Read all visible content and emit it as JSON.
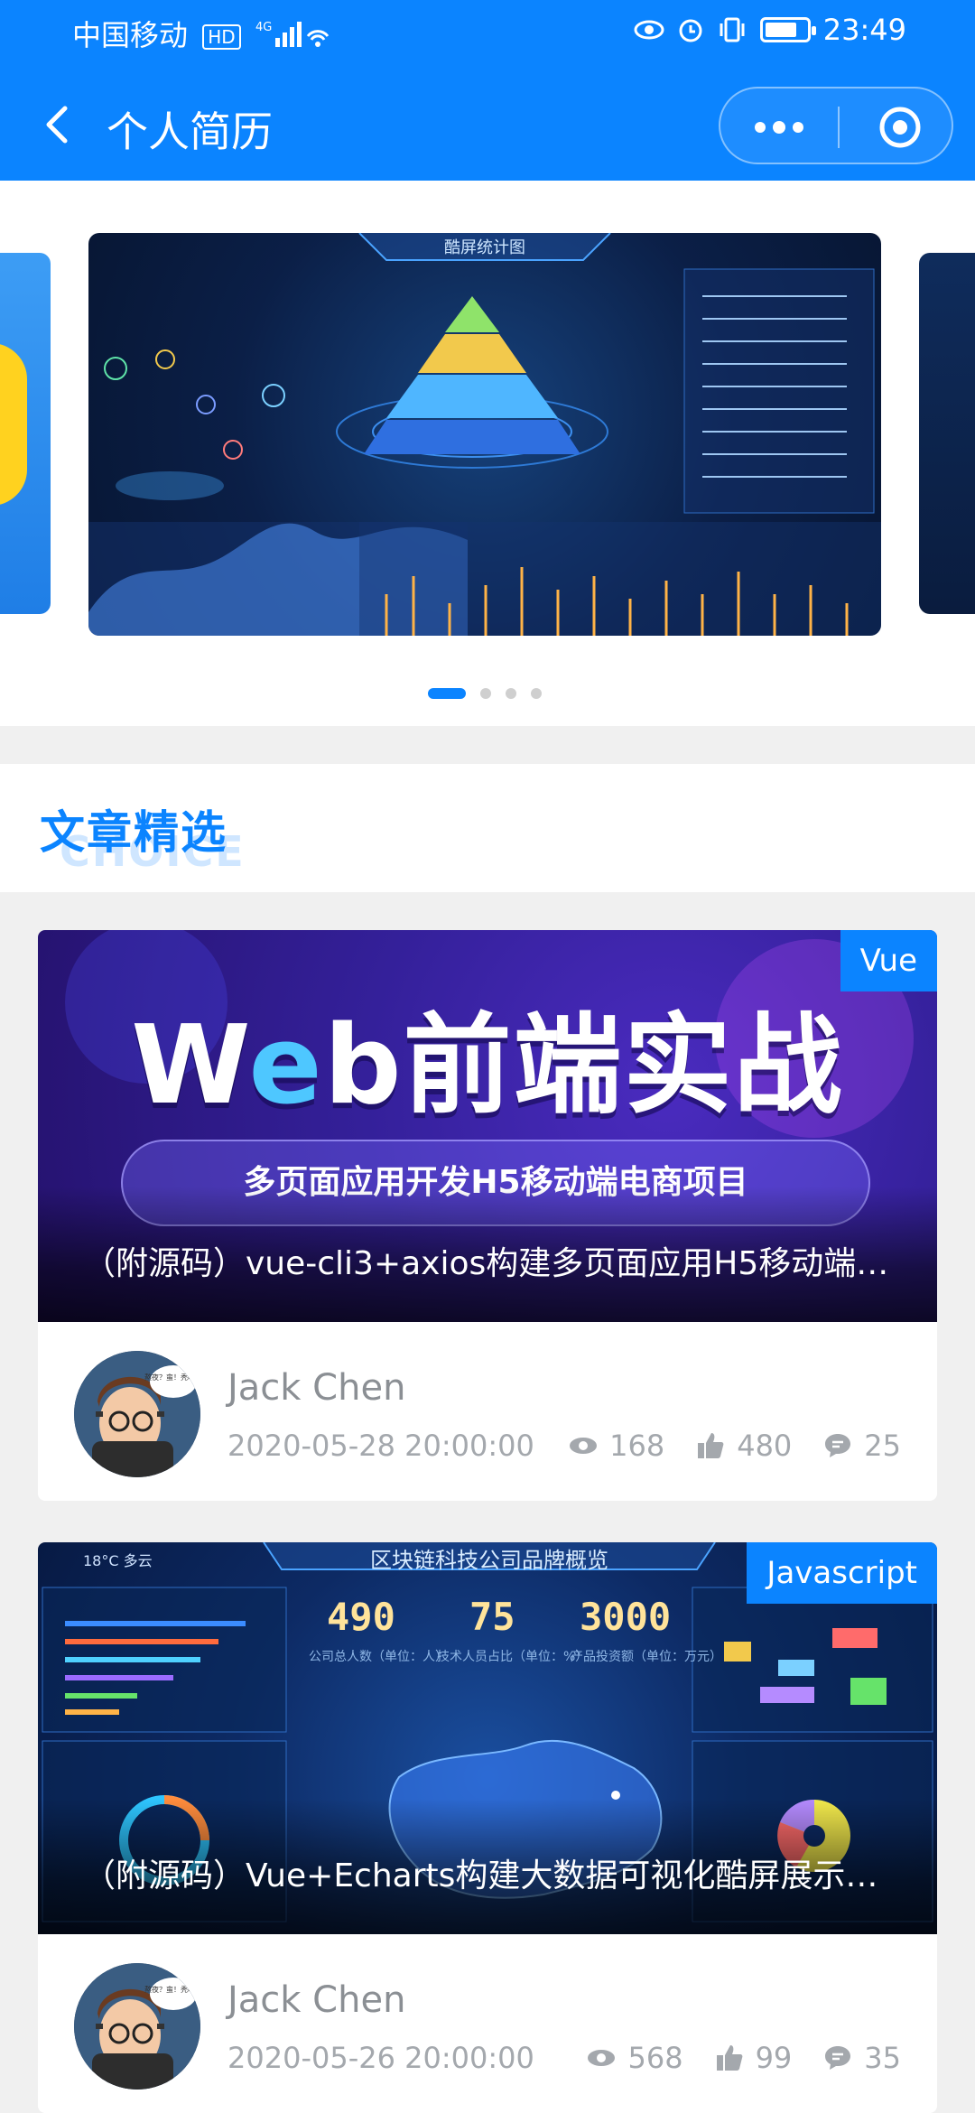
{
  "status_bar": {
    "carrier": "中国移动",
    "hd": "HD",
    "network": "4G",
    "time": "23:49"
  },
  "header": {
    "title": "个人简历",
    "back_icon": "chevron-left-icon",
    "more_icon": "more-dots-icon",
    "close_icon": "target-close-icon",
    "color": "#0b84ff"
  },
  "carousel": {
    "main_slide_title": "酷屏统计图",
    "slide_count": 4,
    "active_index": 0
  },
  "section": {
    "title": "文章精选",
    "subtitle": "CHOICE"
  },
  "articles": [
    {
      "tag": "Vue",
      "cover_title_a": "W",
      "cover_title_e": "e",
      "cover_title_b": "b前端实战",
      "cover_subtitle": "多页面应用开发H5移动端电商项目",
      "title": "（附源码）vue-cli3+axios构建多页面应用H5移动端…",
      "author": "Jack Chen",
      "date": "2020-05-28 20:00:00",
      "views": "168",
      "likes": "480",
      "comments": "25"
    },
    {
      "tag": "Javascript",
      "cover_title": "区块链科技公司品牌概览",
      "weather": "18°C 多云",
      "metrics": [
        {
          "value": "490",
          "label": "公司总人数（单位：人）"
        },
        {
          "value": "75",
          "label": "技术人员占比（单位：%）"
        },
        {
          "value": "3000",
          "label": "产品投资额（单位：万元）"
        }
      ],
      "title": "（附源码）Vue+Echarts构建大数据可视化酷屏展示…",
      "author": "Jack Chen",
      "date": "2020-05-26 20:00:00",
      "views": "568",
      "likes": "99",
      "comments": "35"
    }
  ],
  "avatar_bubble": "熬夜？蛮！秃吗？"
}
